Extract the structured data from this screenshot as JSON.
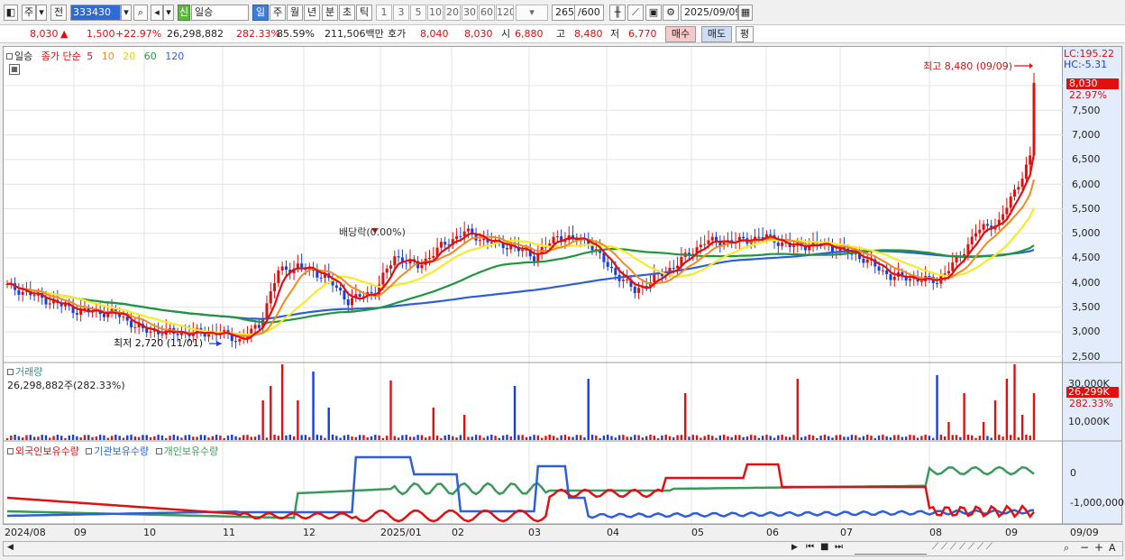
{
  "toolbar": {
    "market": "주",
    "prev": "전",
    "code": "333430",
    "name": "일승",
    "name_badge": "신",
    "periods": [
      "일",
      "주",
      "월",
      "년",
      "분",
      "초",
      "틱"
    ],
    "ticks": [
      "1",
      "3",
      "5",
      "10",
      "20",
      "30",
      "60",
      "120"
    ],
    "count": "265",
    "count_total": "/600",
    "date": "2025/09/09"
  },
  "infobar": {
    "price": "8,030",
    "up_mark": "▲",
    "change": "1,500",
    "change_pct": "+22.97%",
    "volume": "26,298,882",
    "volume_pct": "282.33%",
    "ratio": "85.59%",
    "amount": "211,506백만",
    "quote_label": "호가",
    "quote1": "8,040",
    "quote2": "8,030",
    "open_label": "시",
    "open": "6,880",
    "high_label": "고",
    "high": "8,480",
    "low_label": "저",
    "low": "6,770",
    "buy": "매수",
    "sell": "매도",
    "avg": "평"
  },
  "legend": {
    "name": "일승",
    "price_label": "종가 단순",
    "ma": [
      "5",
      "10",
      "20",
      "60",
      "120"
    ]
  },
  "annotations": {
    "high": "최고 8,480 (09/09)",
    "low": "최저 2,720 (11/01)",
    "dividend": "배당락(0.00%)"
  },
  "right_axis": {
    "lc": "LC:195.22",
    "hc": "HC:-5.31",
    "current": "8,030",
    "current_pct": "22.97%",
    "prices": [
      "7,500",
      "7,000",
      "6,500",
      "6,000",
      "5,500",
      "5,000",
      "4,500",
      "4,000",
      "3,500",
      "3,000",
      "2,500"
    ],
    "vol_ticks": [
      "30,000K",
      "10,000K"
    ],
    "vol_current": "26,299K",
    "vol_pct": "282.33%",
    "hold_ticks": [
      "0",
      "-1,000,000"
    ],
    "date_tail": "09/09"
  },
  "volume_panel": {
    "title": "거래량",
    "value": "26,298,882주(282.33%)"
  },
  "holdings_panel": {
    "series": [
      "외국인보유수량",
      "기관보유수량",
      "개인보유수량"
    ]
  },
  "x_axis": [
    "2024/08",
    "09",
    "10",
    "11",
    "12",
    "2025/01",
    "02",
    "03",
    "04",
    "05",
    "06",
    "07",
    "08",
    "09"
  ],
  "colors": {
    "up": "#e01010",
    "down": "#1a3fd8",
    "ma5": "#e01010",
    "ma10": "#f08c1e",
    "ma20": "#f5ec27",
    "ma60": "#219640",
    "ma120": "#2f5fd8",
    "foreign": "#e01010",
    "institution": "#2f5fd8",
    "individual": "#3a9a5a"
  }
}
